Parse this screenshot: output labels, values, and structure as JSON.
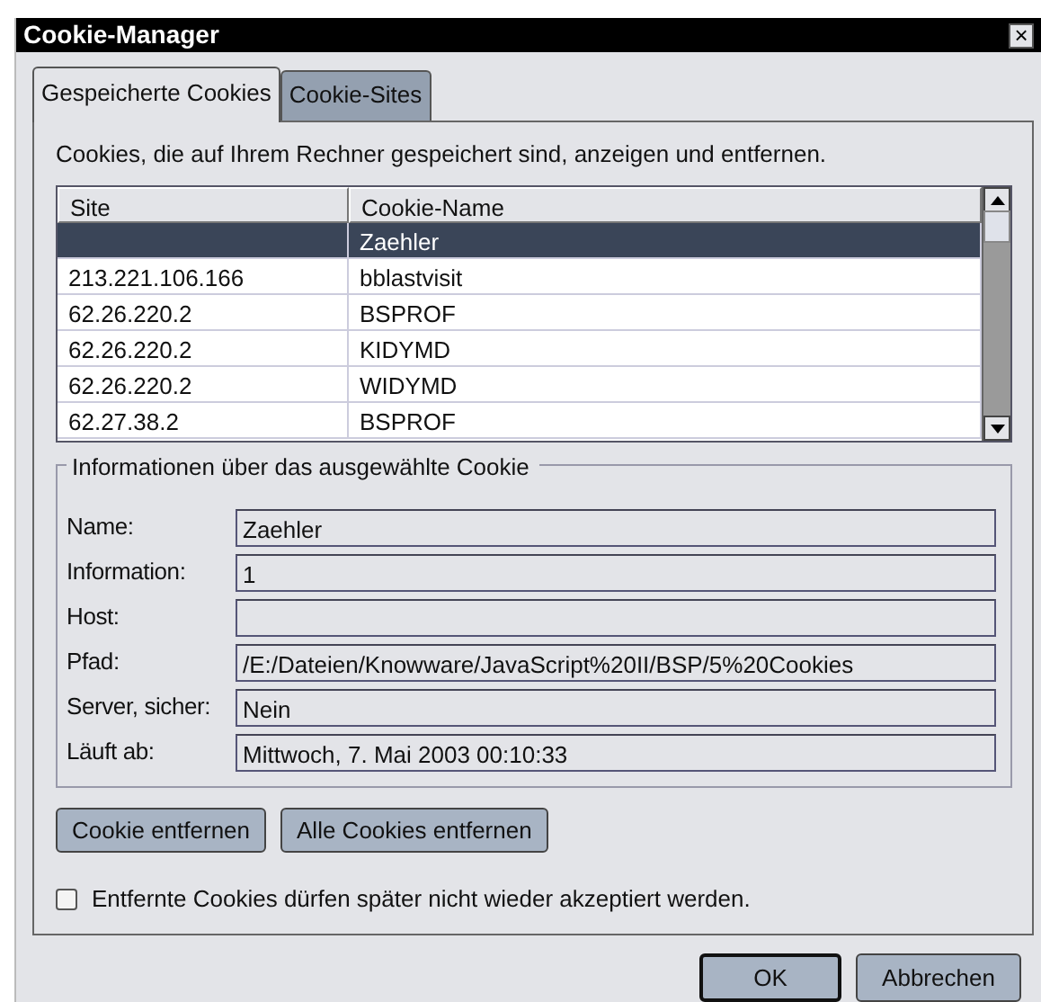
{
  "window": {
    "title": "Cookie-Manager",
    "close": "×"
  },
  "tabs": [
    {
      "label": "Gespeicherte Cookies",
      "selected": true
    },
    {
      "label": "Cookie-Sites",
      "selected": false
    }
  ],
  "description": "Cookies, die auf Ihrem Rechner gespeichert sind, anzeigen und entfernen.",
  "table": {
    "columns": [
      "Site",
      "Cookie-Name"
    ],
    "rows": [
      {
        "name": "Zaehler",
        "selected": true
      },
      {
        "site": "213.221.106.166",
        "name": "bblastvisit",
        "selected": false
      },
      {
        "site": "62.26.220.2",
        "name": "BSPROF",
        "selected": false
      },
      {
        "site": "62.26.220.2",
        "name": "KIDYMD",
        "selected": false
      },
      {
        "site": "62.26.220.2",
        "name": "WIDYMD",
        "selected": false
      },
      {
        "site": "62.27.38.2",
        "name": "BSPROF",
        "selected": false
      }
    ]
  },
  "details": {
    "legend": "Informationen über das ausgewählte Cookie",
    "fields": [
      {
        "label": "Name:",
        "value": "Zaehler"
      },
      {
        "label": "Information:",
        "value": "1"
      },
      {
        "label": "Host:"
      },
      {
        "label": "Pfad:",
        "value": "/E:/Dateien/Knowware/JavaScript%20II/BSP/5%20Cookies"
      },
      {
        "label": "Server, sicher:",
        "value": "Nein"
      },
      {
        "label": "Läuft ab:",
        "value": "Mittwoch, 7. Mai 2003 00:10:33"
      }
    ]
  },
  "actions": [
    "Cookie entfernen",
    "Alle Cookies entfernen"
  ],
  "block_option": {
    "label": "Entfernte Cookies dürfen später nicht wieder akzeptiert werden.",
    "checked": false
  },
  "buttons": [
    {
      "label": "OK",
      "default": true
    },
    {
      "label": "Abbrechen",
      "default": false
    }
  ]
}
